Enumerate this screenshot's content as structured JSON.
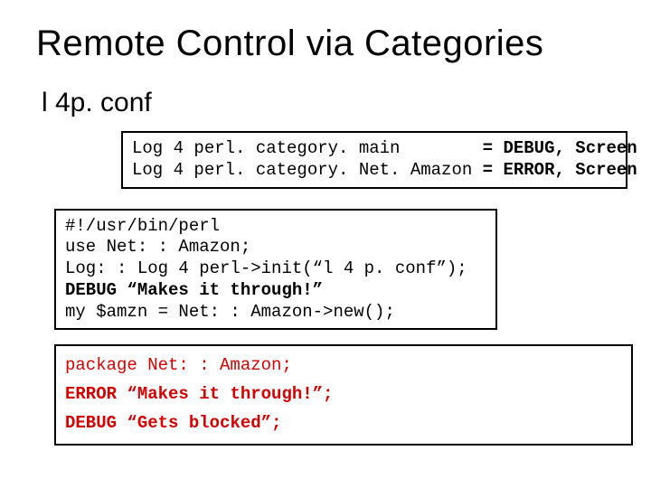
{
  "title": "Remote Control via Categories",
  "subhead": "l 4p. conf",
  "conf": {
    "l1_key": "Log 4 perl. category. main",
    "l1_pad": "        ",
    "l1_val": "= DEBUG, Screen",
    "l2_key": "Log 4 perl. category. Net. Amazon ",
    "l2_val": "= ERROR, Screen"
  },
  "script": {
    "l1": "#!/usr/bin/perl",
    "l2": "use Net: : Amazon;",
    "l3": "Log: : Log 4 perl->init(“l 4 p. conf”);",
    "l4": "DEBUG “Makes it through!”",
    "l5": "my $amzn = Net: : Amazon->new();"
  },
  "pkg": {
    "l1": "package Net: : Amazon;",
    "l2_a": "ERROR ",
    "l2_b": "“Makes it through!”;",
    "l3_a": "DEBUG ",
    "l3_b": "“Gets blocked”;"
  }
}
